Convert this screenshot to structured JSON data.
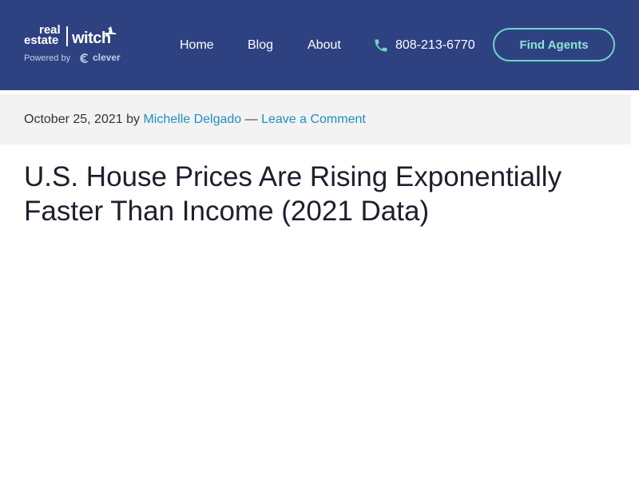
{
  "brand": {
    "logo_line1": "real",
    "logo_line2": "estate",
    "logo_witch": "witch",
    "powered_by": "Powered by",
    "partner": "clever",
    "accent_color": "#6fd6c4",
    "header_color": "#2e4282",
    "link_color": "#1f8fc4"
  },
  "nav": {
    "items": [
      {
        "label": "Home"
      },
      {
        "label": "Blog"
      },
      {
        "label": "About"
      }
    ],
    "phone_icon": "phone-icon",
    "phone": "808-213-6770",
    "cta": "Find Agents"
  },
  "post": {
    "date": "October 25, 2021",
    "by": "by",
    "author": "Michelle Delgado",
    "separator": "—",
    "comment_link": "Leave a Comment",
    "title": "U.S. House Prices Are Rising Exponentially Faster Than Income (2021 Data)"
  }
}
